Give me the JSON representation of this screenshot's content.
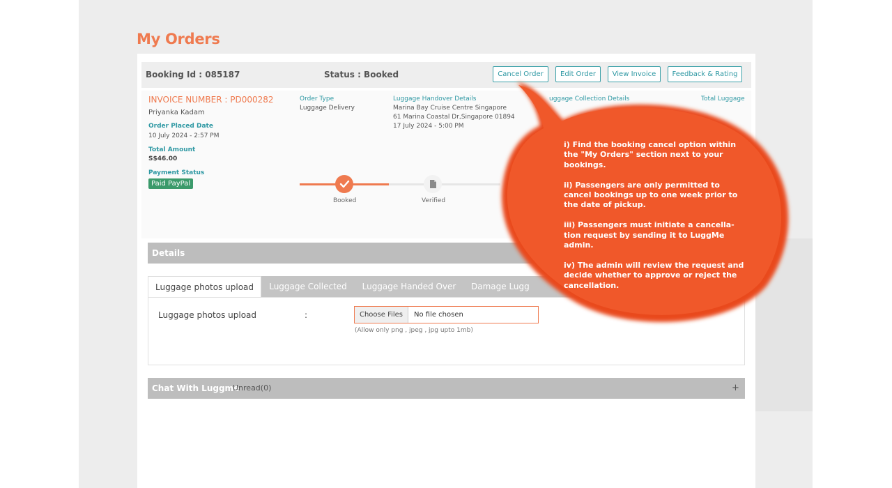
{
  "page": {
    "title": "My Orders"
  },
  "booking_bar": {
    "booking_id": "Booking Id : 085187",
    "status": "Status : Booked",
    "buttons": {
      "cancel_order": "Cancel Order",
      "edit_order": "Edit Order",
      "view_invoice": "View Invoice",
      "feedback": "Feedback & Rating"
    }
  },
  "order": {
    "invoice_number": "INVOICE NUMBER : PD000282",
    "customer_name": "Priyanka Kadam",
    "order_placed_label": "Order Placed Date",
    "order_placed_value": "10 July 2024 - 2:57 PM",
    "total_amount_label": "Total Amount",
    "total_amount_value": "S$46.00",
    "payment_status_label": "Payment Status",
    "payment_status_value": "Paid PayPal",
    "order_type_label": "Order Type",
    "order_type_value": "Luggage Delivery",
    "handover_label": "Luggage Handover Details",
    "handover_line1": "Marina Bay Cruise Centre Singapore",
    "handover_line2": "61 Marina Coastal Dr,Singapore 01894",
    "handover_date": "17 July 2024 - 5:00 PM",
    "collection_label": "uggage Collection Details",
    "total_luggage_label": "Total Luggage"
  },
  "progress": {
    "steps": [
      {
        "label": "Booked",
        "state": "done"
      },
      {
        "label": "Verified",
        "state": "pending"
      }
    ]
  },
  "details": {
    "header": "Details",
    "tabs": [
      {
        "label": "Luggage photos upload",
        "active": true
      },
      {
        "label": "Luggage Collected",
        "active": false
      },
      {
        "label": "Luggage Handed Over",
        "active": false
      },
      {
        "label": "Damage Lugg",
        "active": false
      }
    ],
    "upload_label": "Luggage photos upload",
    "colon": ":",
    "choose_files": "Choose Files",
    "no_file": "No file chosen",
    "hint": "(Allow only png , jpeg , jpg upto 1mb)"
  },
  "chat": {
    "title": "Chat With Luggme",
    "unread": "Unread(0)",
    "expand": "+"
  },
  "callout": {
    "items": [
      "i) Find the booking cancel option within the \"My Orders\" section next to your bookings.",
      "ii) Passengers are only permitted to cancel bookings up to one week prior to the date of pickup.",
      "iii) Passengers must initiate a cancella-tion request by sending it to LuggMe admin.",
      "iv) The admin will review the request and decide whether to approve or reject the cancellation."
    ]
  },
  "colors": {
    "accent": "#ef7a4f",
    "teal": "#2e98a3",
    "callout": "#f0582a",
    "paid_badge": "#3b9a6b"
  }
}
